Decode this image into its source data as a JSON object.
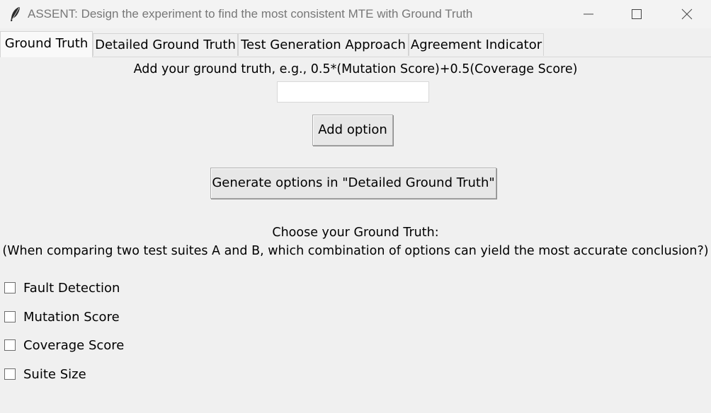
{
  "window": {
    "title": "ASSENT: Design the experiment to find the most consistent MTE with Ground Truth",
    "icon": "feather-icon",
    "controls": [
      "minimize-icon",
      "maximize-icon",
      "close-icon"
    ]
  },
  "tabs": [
    {
      "label": "Ground Truth",
      "active": true
    },
    {
      "label": "Detailed Ground Truth",
      "active": false
    },
    {
      "label": "Test Generation Approach",
      "active": false
    },
    {
      "label": "Agreement Indicator",
      "active": false
    }
  ],
  "ground_truth": {
    "instruction": "Add your ground truth, e.g., 0.5*(Mutation Score)+0.5(Coverage Score)",
    "input_value": "",
    "add_button": "Add option",
    "generate_button": "Generate options in \"Detailed Ground Truth\"",
    "choose_heading": "Choose your Ground Truth:",
    "choose_subheading": "(When comparing two test suites A and B, which combination of options can yield the most accurate conclusion?)",
    "options": [
      {
        "label": "Fault Detection",
        "checked": false
      },
      {
        "label": "Mutation Score",
        "checked": false
      },
      {
        "label": "Coverage Score",
        "checked": false
      },
      {
        "label": "Suite Size",
        "checked": false
      }
    ]
  }
}
